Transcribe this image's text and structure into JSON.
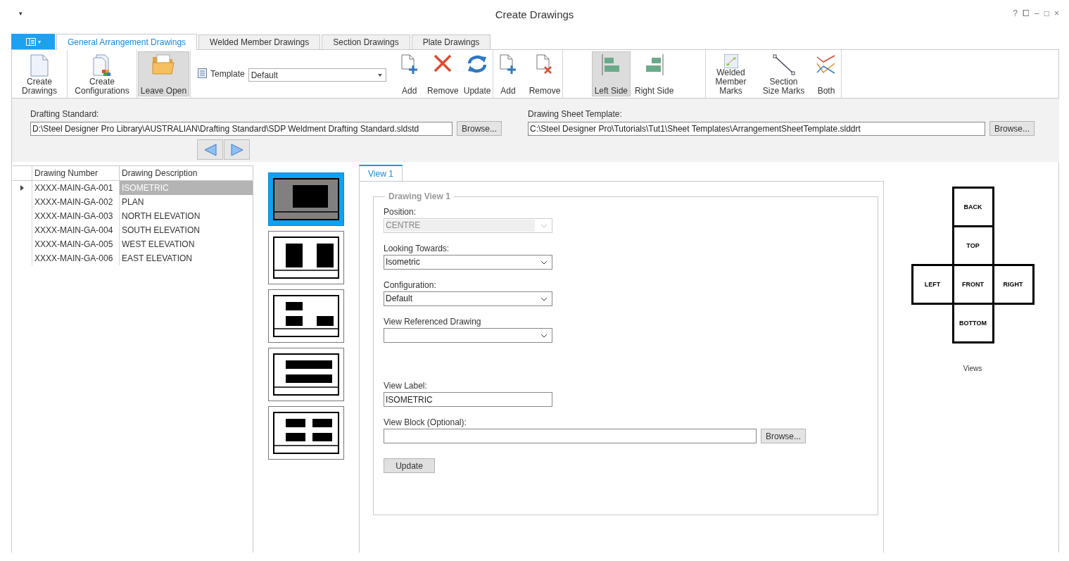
{
  "window": {
    "title": "Create Drawings",
    "menu_glyph": "▾",
    "controls": [
      "?",
      "⧠",
      "–",
      "□",
      "×"
    ]
  },
  "app_menu_caret": "▾",
  "tabs": [
    {
      "label": "General Arrangement Drawings",
      "selected": true
    },
    {
      "label": "Welded Member Drawings",
      "selected": false
    },
    {
      "label": "Section Drawings",
      "selected": false
    },
    {
      "label": "Plate Drawings",
      "selected": false
    }
  ],
  "ribbon": [
    {
      "items": [
        {
          "kind": "page",
          "label": "Create Drawings",
          "pressed": false
        }
      ]
    },
    {
      "items": [
        {
          "kind": "configs",
          "label": "Create Configurations",
          "pressed": false
        }
      ]
    },
    {
      "items": [
        {
          "kind": "folder",
          "label": "Leave Open",
          "pressed": true
        }
      ]
    },
    {
      "template": {
        "label": "Template",
        "value": "Default"
      },
      "items": [
        {
          "kind": "add",
          "label": "Add",
          "pressed": false
        },
        {
          "kind": "remove",
          "label": "Remove",
          "pressed": false
        },
        {
          "kind": "update",
          "label": "Update",
          "pressed": false
        }
      ]
    },
    {
      "items": [
        {
          "kind": "add",
          "label": "Add",
          "pressed": false
        },
        {
          "kind": "remove-page",
          "label": "Remove",
          "pressed": false
        }
      ]
    },
    {
      "items": [
        {
          "kind": "left",
          "label": "Left Side",
          "pressed": true
        },
        {
          "kind": "right",
          "label": "Right Side",
          "pressed": false
        }
      ]
    },
    {
      "items": [
        {
          "kind": "welded",
          "label": "Welded Member Marks",
          "pressed": false
        },
        {
          "kind": "section",
          "label": "Section Size Marks",
          "pressed": false
        },
        {
          "kind": "both",
          "label": "Both",
          "pressed": false
        }
      ]
    }
  ],
  "drafting_standard": {
    "label": "Drafting Standard:",
    "value": "D:\\Steel Designer Pro Library\\AUSTRALIAN\\Drafting Standard\\SDP Weldment Drafting Standard.sldstd",
    "button": "Browse..."
  },
  "sheet_template": {
    "label": "Drawing Sheet Template:",
    "value": "C:\\Steel Designer Pro\\Tutorials\\Tut1\\Sheet Templates\\ArrangementSheetTemplate.slddrt",
    "button": "Browse..."
  },
  "table": {
    "columns": [
      "Drawing Number",
      "Drawing Description"
    ],
    "rows": [
      {
        "number": "XXXX-MAIN-GA-001",
        "description": "ISOMETRIC",
        "selected": true
      },
      {
        "number": "XXXX-MAIN-GA-002",
        "description": "PLAN",
        "selected": false
      },
      {
        "number": "XXXX-MAIN-GA-003",
        "description": "NORTH ELEVATION",
        "selected": false
      },
      {
        "number": "XXXX-MAIN-GA-004",
        "description": "SOUTH ELEVATION",
        "selected": false
      },
      {
        "number": "XXXX-MAIN-GA-005",
        "description": "WEST ELEVATION",
        "selected": false
      },
      {
        "number": "XXXX-MAIN-GA-006",
        "description": "EAST ELEVATION",
        "selected": false
      }
    ]
  },
  "layouts": [
    {
      "kind": "single",
      "selected": true
    },
    {
      "kind": "two-columns",
      "selected": false
    },
    {
      "kind": "three",
      "selected": false
    },
    {
      "kind": "two-rows",
      "selected": false
    },
    {
      "kind": "four",
      "selected": false
    }
  ],
  "view_tabs": [
    {
      "label": "View 1",
      "selected": true
    }
  ],
  "drawing_view": {
    "legend": "Drawing View 1",
    "dropdowns": [
      {
        "label": "Position:",
        "value": "CENTRE",
        "disabled": true
      },
      {
        "label": "Looking Towards:",
        "value": "Isometric",
        "disabled": false
      },
      {
        "label": "Configuration:",
        "value": "Default",
        "disabled": false
      },
      {
        "label": "View Referenced Drawing",
        "disabled": false
      }
    ],
    "view_label": {
      "label": "View Label:",
      "value": "ISOMETRIC"
    },
    "view_block": {
      "label": "View Block (Optional):",
      "button": "Browse..."
    },
    "update_button": "Update"
  },
  "views": {
    "faces": [
      "BACK",
      "TOP",
      "LEFT",
      "FRONT",
      "RIGHT",
      "BOTTOM"
    ],
    "caption": "Views"
  }
}
